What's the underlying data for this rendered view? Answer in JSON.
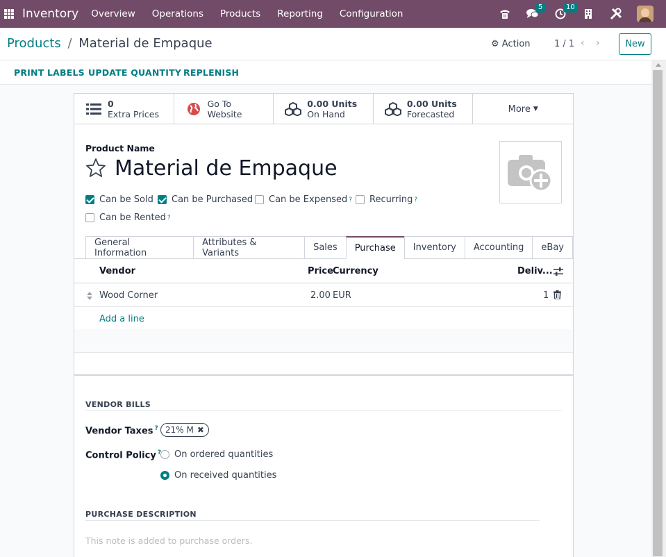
{
  "navbar": {
    "app_name": "Inventory",
    "menu": [
      "Overview",
      "Operations",
      "Products",
      "Reporting",
      "Configuration"
    ],
    "messages_count": "5",
    "activities_count": "10"
  },
  "control_panel": {
    "breadcrumb_parent": "Products",
    "breadcrumb_separator": "/",
    "breadcrumb_current": "Material de Empaque",
    "action_label": "Action",
    "pager": "1 / 1",
    "new_label": "New"
  },
  "header_buttons": [
    "PRINT LABELS",
    "UPDATE QUANTITY",
    "REPLENISH"
  ],
  "smart_buttons": {
    "extra_prices": {
      "value": "0",
      "label": "Extra Prices"
    },
    "website": {
      "value": "Go To",
      "label": "Website"
    },
    "on_hand": {
      "value": "0.00 Units",
      "label": "On Hand"
    },
    "forecasted": {
      "value": "0.00 Units",
      "label": "Forecasted"
    },
    "more": "More"
  },
  "form": {
    "product_name_label": "Product Name",
    "product_name": "Material de Empaque",
    "checkboxes": {
      "can_be_sold": {
        "label": "Can be Sold",
        "checked": true
      },
      "can_be_purchased": {
        "label": "Can be Purchased",
        "checked": true
      },
      "can_be_expensed": {
        "label": "Can be Expensed",
        "checked": false
      },
      "recurring": {
        "label": "Recurring",
        "checked": false
      },
      "can_be_rented": {
        "label": "Can be Rented",
        "checked": false
      }
    },
    "help_mark": "?"
  },
  "tabs": [
    "General Information",
    "Attributes & Variants",
    "Sales",
    "Purchase",
    "Inventory",
    "Accounting",
    "eBay"
  ],
  "active_tab": "Purchase",
  "vendor_list": {
    "headers": {
      "vendor": "Vendor",
      "price": "Price",
      "currency": "Currency",
      "delivery": "Deliv..."
    },
    "rows": [
      {
        "vendor": "Wood Corner",
        "price": "2.00",
        "currency": "EUR",
        "delivery": "1"
      }
    ],
    "add_line": "Add a line"
  },
  "vendor_bills": {
    "section_title": "VENDOR BILLS",
    "vendor_taxes_label": "Vendor Taxes",
    "tax_tag": "21% M",
    "control_policy_label": "Control Policy",
    "policy_options": [
      {
        "label": "On ordered quantities",
        "selected": false
      },
      {
        "label": "On received quantities",
        "selected": true
      }
    ]
  },
  "purchase_description": {
    "section_title": "PURCHASE DESCRIPTION",
    "placeholder": "This note is added to purchase orders."
  },
  "colors": {
    "brand": "#714b67",
    "accent": "#017e84"
  }
}
